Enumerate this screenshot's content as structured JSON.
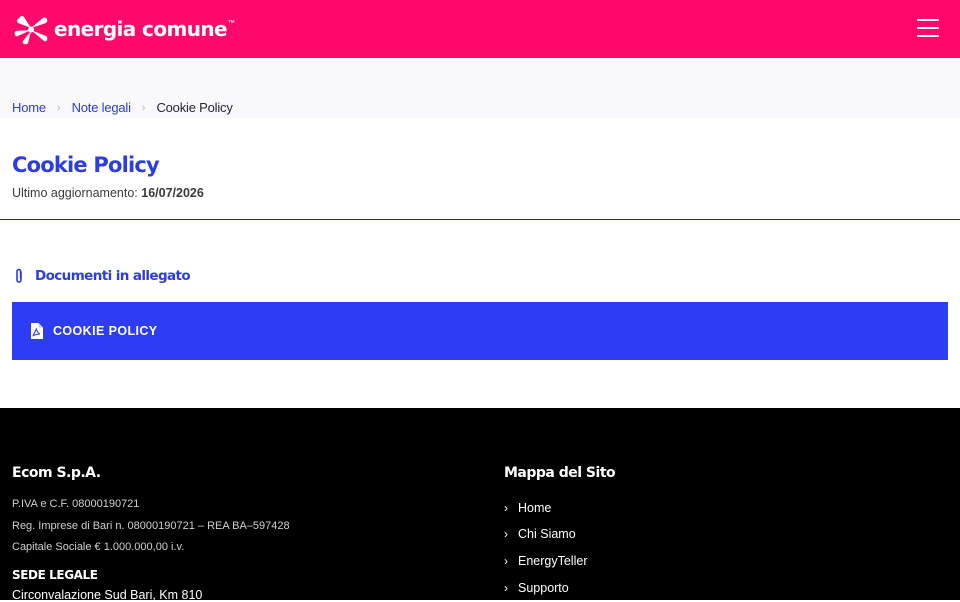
{
  "header": {
    "brand": "energia comune",
    "trademark": "™",
    "menu_icon": "hamburger-menu-icon",
    "bg_color": "#ff0a6c"
  },
  "breadcrumb": {
    "items": [
      "Home",
      "Note legali"
    ],
    "current": "Cookie Policy",
    "separator": "›"
  },
  "page": {
    "title": "Cookie Policy",
    "updated_label": "Ultimo aggiornamento:",
    "updated_date": "16/07/2026",
    "accent_color": "#2c3de5"
  },
  "attachments": {
    "heading": "Documenti in allegato",
    "heading_icon": "paperclip-icon",
    "items": [
      {
        "label": "COOKIE POLICY",
        "icon": "pdf-file-icon"
      }
    ]
  },
  "footer": {
    "company_name": "Ecom S.p.A.",
    "lines": [
      "P.IVA e C.F. 08000190721",
      "Reg. Imprese di Bari n. 08000190721 – REA BA–597428",
      "Capitale Sociale € 1.000.000,00 i.v."
    ],
    "sede_heading": "SEDE LEGALE",
    "address": "Circonvalazione Sud Bari, Km 810",
    "sitemap_title": "Mappa del Sito",
    "sitemap": [
      "Home",
      "Chi Siamo",
      "EnergyTeller",
      "Supporto"
    ],
    "chevron": "›"
  }
}
